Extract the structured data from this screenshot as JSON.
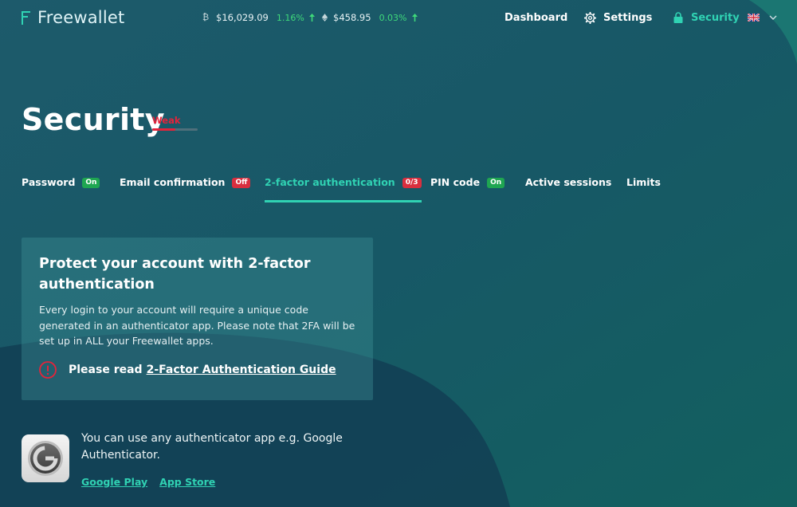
{
  "header": {
    "brand": "Freewallet",
    "tickers": [
      {
        "symbol_icon": "bitcoin-icon",
        "price": "$16,029.09",
        "change": "1.16%"
      },
      {
        "symbol_icon": "ethereum-icon",
        "price": "$458.95",
        "change": "0.03%"
      }
    ],
    "nav": {
      "dashboard": "Dashboard",
      "settings": "Settings",
      "security": "Security"
    }
  },
  "page": {
    "title": "Security",
    "strength_label": "Weak",
    "strength_level": 0.5
  },
  "tabs": [
    {
      "label": "Password",
      "badge": "On"
    },
    {
      "label": "Email confirmation",
      "badge": "Off"
    },
    {
      "label": "2-factor authentication",
      "badge": "0/3"
    },
    {
      "label": "PIN code",
      "badge": "On"
    },
    {
      "label": "Active sessions"
    },
    {
      "label": "Limits"
    }
  ],
  "card": {
    "title": "Protect your account with 2-factor authentication",
    "description": "Every login to your account will require a unique code generated in an authenticator app. Please note that 2FA will be set up in ALL your Freewallet apps.",
    "guide_prefix": "Please read",
    "guide_link": "2-Factor Authentication Guide"
  },
  "authenticator": {
    "text": "You can use any authenticator app e.g. Google Authenticator.",
    "google_play": "Google Play",
    "app_store": "App Store"
  },
  "colors": {
    "accent": "#30d2b3",
    "danger": "#e3243b",
    "success": "#1fa651"
  }
}
